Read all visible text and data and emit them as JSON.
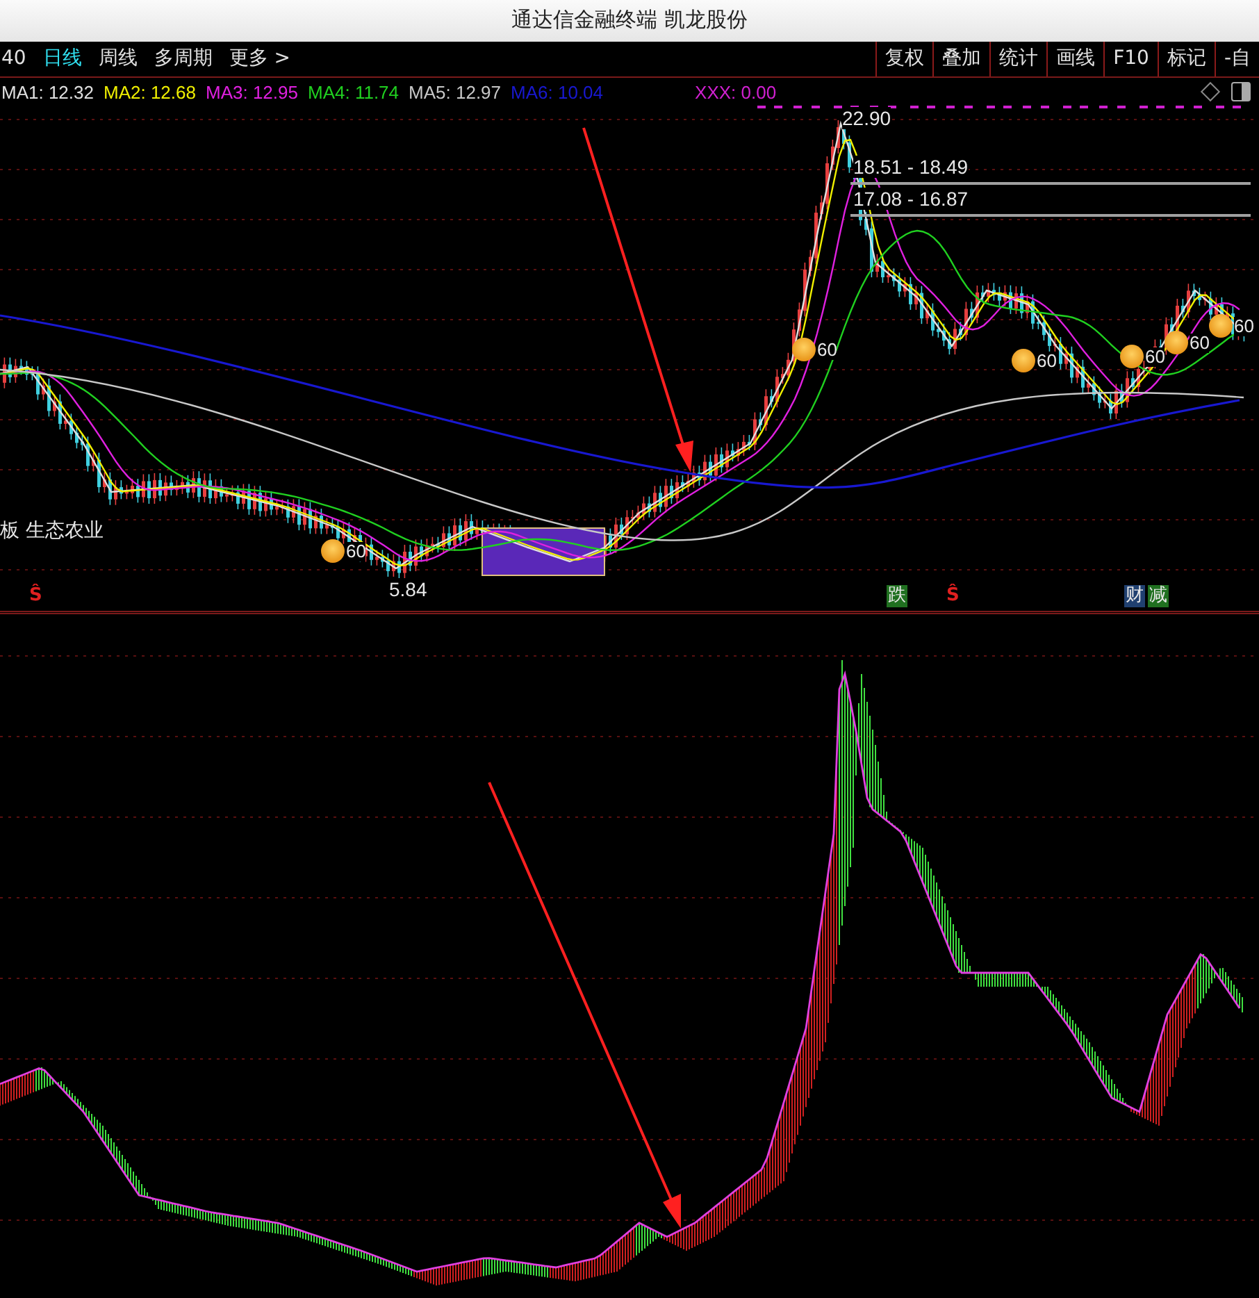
{
  "window": {
    "title": "通达信金融终端 凯龙股份"
  },
  "toolbar": {
    "left": [
      {
        "label": "40",
        "selected": false
      },
      {
        "label": "日线",
        "selected": true
      },
      {
        "label": "周线",
        "selected": false
      },
      {
        "label": "多周期",
        "selected": false
      },
      {
        "label": "更多 >",
        "selected": false
      }
    ],
    "right": [
      "复权",
      "叠加",
      "统计",
      "画线",
      "F10",
      "标记",
      "-自"
    ]
  },
  "legend": [
    {
      "label": "MA1: 12.32",
      "color": "#e0e0e0"
    },
    {
      "label": "MA2: 12.68",
      "color": "#f0f000"
    },
    {
      "label": "MA3: 12.95",
      "color": "#e020e0"
    },
    {
      "label": "MA4: 11.74",
      "color": "#20d020"
    },
    {
      "label": "MA5: 12.97",
      "color": "#c8c8c8"
    },
    {
      "label": "MA6: 10.04",
      "color": "#1818d0"
    }
  ],
  "indicator_legend": {
    "label": "XXX: 0.00",
    "color": "#d020d0"
  },
  "price_labels": {
    "high": "22.90",
    "low": "5.84",
    "band_1": "18.51 - 18.49",
    "band_2": "17.08 - 16.87",
    "sector": "板 生态农业"
  },
  "signals": [
    {
      "text": "60"
    },
    {
      "text": "60"
    },
    {
      "text": "60"
    },
    {
      "text": "60"
    },
    {
      "text": "60"
    },
    {
      "text": "60"
    }
  ],
  "event_marks": [
    {
      "text": "Ŝ",
      "kind": "plain",
      "color": "#e02020"
    },
    {
      "text": "跌",
      "kind": "tag",
      "color": "#207020"
    },
    {
      "text": "Ŝ",
      "kind": "plain",
      "color": "#e02020"
    },
    {
      "text": "财",
      "kind": "tag",
      "color": "#204070"
    },
    {
      "text": "减",
      "kind": "tag",
      "color": "#207020"
    }
  ]
}
